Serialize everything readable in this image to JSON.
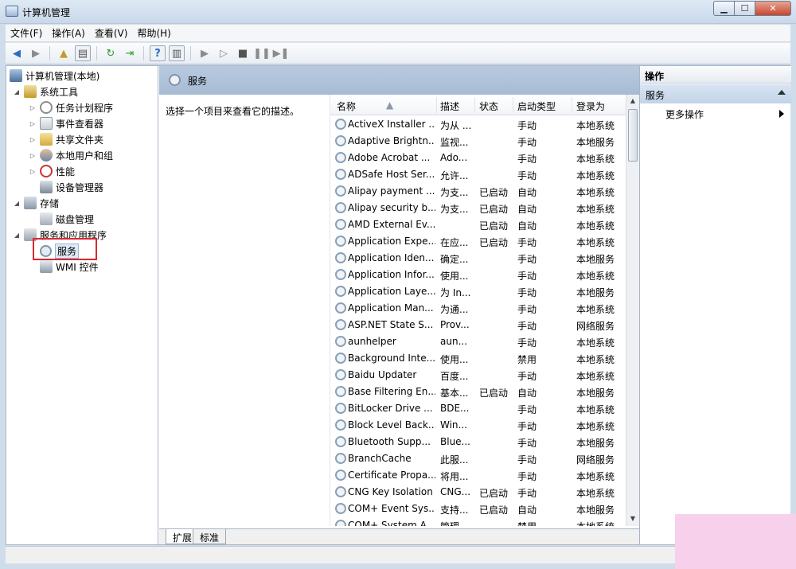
{
  "window": {
    "title": "计算机管理"
  },
  "menu": [
    "文件(F)",
    "操作(A)",
    "查看(V)",
    "帮助(H)"
  ],
  "tree": {
    "root": "计算机管理(本地)",
    "system_tools": "系统工具",
    "task_scheduler": "任务计划程序",
    "event_viewer": "事件查看器",
    "shared_folders": "共享文件夹",
    "local_users": "本地用户和组",
    "performance": "性能",
    "device_manager": "设备管理器",
    "storage": "存储",
    "disk_management": "磁盘管理",
    "services_apps": "服务和应用程序",
    "services": "服务",
    "wmi": "WMI 控件"
  },
  "center": {
    "header": "服务",
    "description_hint": "选择一个项目来查看它的描述。",
    "columns": [
      "名称",
      "描述",
      "状态",
      "启动类型",
      "登录为"
    ],
    "rows": [
      [
        "ActiveX Installer ...",
        "为从 ...",
        "",
        "手动",
        "本地系统"
      ],
      [
        "Adaptive Brightn...",
        "监视...",
        "",
        "手动",
        "本地服务"
      ],
      [
        "Adobe Acrobat ...",
        "Ado...",
        "",
        "手动",
        "本地系统"
      ],
      [
        "ADSafe Host Ser...",
        "允许...",
        "",
        "手动",
        "本地系统"
      ],
      [
        "Alipay payment ...",
        "为支...",
        "已启动",
        "自动",
        "本地系统"
      ],
      [
        "Alipay security b...",
        "为支...",
        "已启动",
        "自动",
        "本地系统"
      ],
      [
        "AMD External Ev...",
        "",
        "已启动",
        "自动",
        "本地系统"
      ],
      [
        "Application Expe...",
        "在应...",
        "已启动",
        "手动",
        "本地系统"
      ],
      [
        "Application Iden...",
        "确定...",
        "",
        "手动",
        "本地服务"
      ],
      [
        "Application Infor...",
        "使用...",
        "",
        "手动",
        "本地系统"
      ],
      [
        "Application Laye...",
        "为 In...",
        "",
        "手动",
        "本地服务"
      ],
      [
        "Application Man...",
        "为通...",
        "",
        "手动",
        "本地系统"
      ],
      [
        "ASP.NET State S...",
        "Prov...",
        "",
        "手动",
        "网络服务"
      ],
      [
        "aunhelper",
        "aun...",
        "",
        "手动",
        "本地系统"
      ],
      [
        "Background Inte...",
        "使用...",
        "",
        "禁用",
        "本地系统"
      ],
      [
        "Baidu Updater",
        "百度...",
        "",
        "手动",
        "本地系统"
      ],
      [
        "Base Filtering En...",
        "基本...",
        "已启动",
        "自动",
        "本地服务"
      ],
      [
        "BitLocker Drive ...",
        "BDE...",
        "",
        "手动",
        "本地系统"
      ],
      [
        "Block Level Back...",
        "Win...",
        "",
        "手动",
        "本地系统"
      ],
      [
        "Bluetooth Supp...",
        "Blue...",
        "",
        "手动",
        "本地服务"
      ],
      [
        "BranchCache",
        "此服...",
        "",
        "手动",
        "网络服务"
      ],
      [
        "Certificate Propa...",
        "将用...",
        "",
        "手动",
        "本地系统"
      ],
      [
        "CNG Key Isolation",
        "CNG...",
        "已启动",
        "手动",
        "本地系统"
      ],
      [
        "COM+ Event Sys...",
        "支持...",
        "已启动",
        "自动",
        "本地服务"
      ],
      [
        "COM+ System A...",
        "管理...",
        "",
        "禁用",
        "本地系统"
      ]
    ]
  },
  "tabs": [
    "扩展",
    "标准"
  ],
  "actions": {
    "title": "操作",
    "section": "服务",
    "more": "更多操作"
  }
}
